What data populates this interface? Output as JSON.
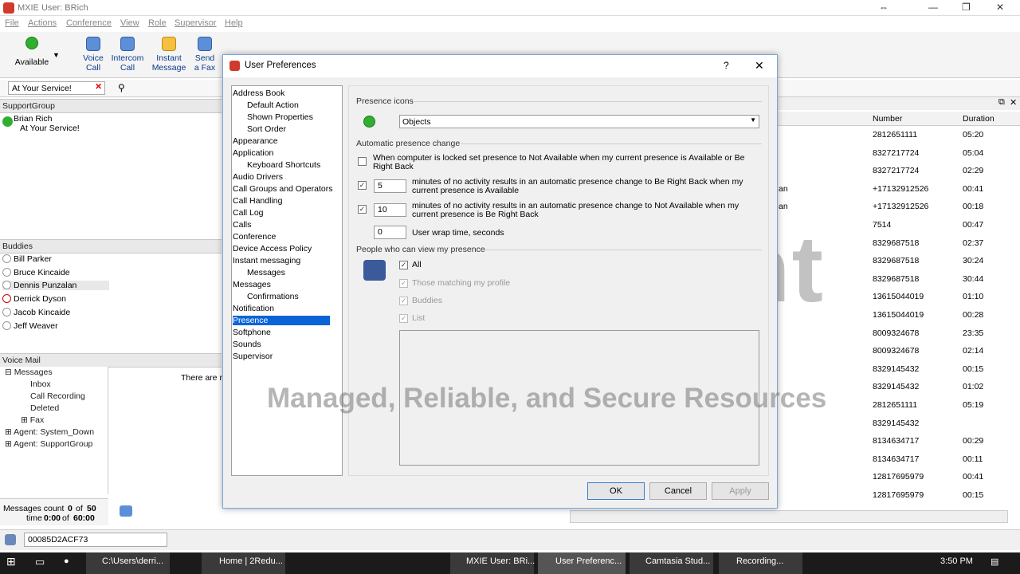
{
  "app": {
    "title": "MXIE User: BRich"
  },
  "menu": [
    "File",
    "Actions",
    "Conference",
    "View",
    "Role",
    "Supervisor",
    "Help"
  ],
  "toolbar": {
    "presence": "Available",
    "buttons": [
      {
        "line1": "Voice",
        "line2": "Call"
      },
      {
        "line1": "Intercom",
        "line2": "Call"
      },
      {
        "line1": "Instant",
        "line2": "Message"
      },
      {
        "line1": "Send",
        "line2": "a Fax"
      }
    ]
  },
  "status_box": "At Your Service!",
  "support_group": {
    "header": "SupportGroup",
    "name": "Brian Rich",
    "status": "At Your Service!"
  },
  "buddies": {
    "header": "Buddies",
    "items": [
      "Bill Parker",
      "Bruce Kincaide",
      "Dennis Punzalan",
      "Derrick Dyson",
      "Jacob Kincaide",
      "Jeff Weaver"
    ]
  },
  "voicemail": {
    "header": "Voice Mail",
    "tree": [
      "Messages",
      "Inbox",
      "Call Recording",
      "Deleted",
      "Fax",
      "Agent: System_Down",
      "Agent: SupportGroup"
    ],
    "side_text": "There are r",
    "count_label": "Messages count",
    "count": "0",
    "of": "of",
    "count_total": "50",
    "time_label": "time",
    "time": "0:00",
    "time_total": "60:00"
  },
  "bottom_status": "00085D2ACF73",
  "calls": {
    "columns": [
      "Number",
      "Duration"
    ],
    "rows": [
      {
        "x": "",
        "number": "2812651111",
        "duration": "05:20"
      },
      {
        "x": "",
        "number": "8327217724",
        "duration": "05:04"
      },
      {
        "x": "",
        "number": "8327217724",
        "duration": "02:29"
      },
      {
        "x": "an",
        "number": "+17132912526",
        "duration": "00:41"
      },
      {
        "x": "an",
        "number": "+17132912526",
        "duration": "00:18"
      },
      {
        "x": "",
        "number": "7514",
        "duration": "00:47"
      },
      {
        "x": "",
        "number": "8329687518",
        "duration": "02:37"
      },
      {
        "x": "",
        "number": "8329687518",
        "duration": "30:24"
      },
      {
        "x": "",
        "number": "8329687518",
        "duration": "30:44"
      },
      {
        "x": "",
        "number": "13615044019",
        "duration": "01:10"
      },
      {
        "x": "",
        "number": "13615044019",
        "duration": "00:28"
      },
      {
        "x": "",
        "number": "8009324678",
        "duration": "23:35"
      },
      {
        "x": "",
        "number": "8009324678",
        "duration": "02:14"
      },
      {
        "x": "",
        "number": "8329145432",
        "duration": "00:15"
      },
      {
        "x": "",
        "number": "8329145432",
        "duration": "01:02"
      },
      {
        "x": "",
        "number": "2812651111",
        "duration": "05:19"
      },
      {
        "x": "",
        "number": "8329145432",
        "duration": ""
      },
      {
        "x": "",
        "number": "8134634717",
        "duration": "00:29"
      },
      {
        "x": "",
        "number": "8134634717",
        "duration": "00:11"
      },
      {
        "x": "",
        "number": "12817695979",
        "duration": "00:41"
      },
      {
        "x": "",
        "number": "12817695979",
        "duration": "00:15"
      }
    ]
  },
  "dialog": {
    "title": "User Preferences",
    "help": "?",
    "nav": [
      {
        "label": "Address Book",
        "indent": 0
      },
      {
        "label": "Default Action",
        "indent": 1
      },
      {
        "label": "Shown Properties",
        "indent": 1
      },
      {
        "label": "Sort Order",
        "indent": 1
      },
      {
        "label": "Appearance",
        "indent": 0
      },
      {
        "label": "Application",
        "indent": 0
      },
      {
        "label": "Keyboard Shortcuts",
        "indent": 1
      },
      {
        "label": "Audio Drivers",
        "indent": 0
      },
      {
        "label": "Call Groups and Operators",
        "indent": 0
      },
      {
        "label": "Call Handling",
        "indent": 0
      },
      {
        "label": "Call Log",
        "indent": 0
      },
      {
        "label": "Calls",
        "indent": 0
      },
      {
        "label": "Conference",
        "indent": 0
      },
      {
        "label": "Device Access Policy",
        "indent": 0
      },
      {
        "label": "Instant messaging",
        "indent": 0
      },
      {
        "label": "Messages",
        "indent": 1
      },
      {
        "label": "Messages",
        "indent": 0
      },
      {
        "label": "Confirmations",
        "indent": 1
      },
      {
        "label": "Notification",
        "indent": 0
      },
      {
        "label": "Presence",
        "indent": 0,
        "selected": true
      },
      {
        "label": "Softphone",
        "indent": 0
      },
      {
        "label": "Sounds",
        "indent": 0
      },
      {
        "label": "Supervisor",
        "indent": 0
      }
    ],
    "presence_icons_label": "Presence icons",
    "presence_icons_value": "Objects",
    "auto_change_label": "Automatic presence change",
    "locked_text": "When computer is locked set presence to Not Available when my current presence is Available or Be Right Back",
    "brb_minutes": "5",
    "brb_text": "minutes of no activity results in an automatic presence change to Be Right Back when my current presence is Available",
    "na_minutes": "10",
    "na_text": "minutes of no activity results in an automatic presence change to Not Available when my current presence is Be Right Back",
    "wrap_value": "0",
    "wrap_text": "User wrap time, seconds",
    "people_label": "People who can view my presence",
    "people_all": "All",
    "people_matching": "Those matching my profile",
    "people_buddies": "Buddies",
    "people_list": "List",
    "ok": "OK",
    "cancel": "Cancel",
    "apply": "Apply"
  },
  "watermark": {
    "logo": "redundant",
    "tagline": "Managed, Reliable, and Secure Resources"
  },
  "taskbar": {
    "items": [
      "C:\\Users\\derri...",
      "Home | 2Redu...",
      "MXIE User: BRi...",
      "User Preferenc...",
      "Camtasia Stud...",
      "Recording..."
    ],
    "clock": "3:50 PM"
  },
  "colors": {
    "selection": "#0a64d8",
    "available": "#2fae2f",
    "link": "#0b3b8c"
  }
}
